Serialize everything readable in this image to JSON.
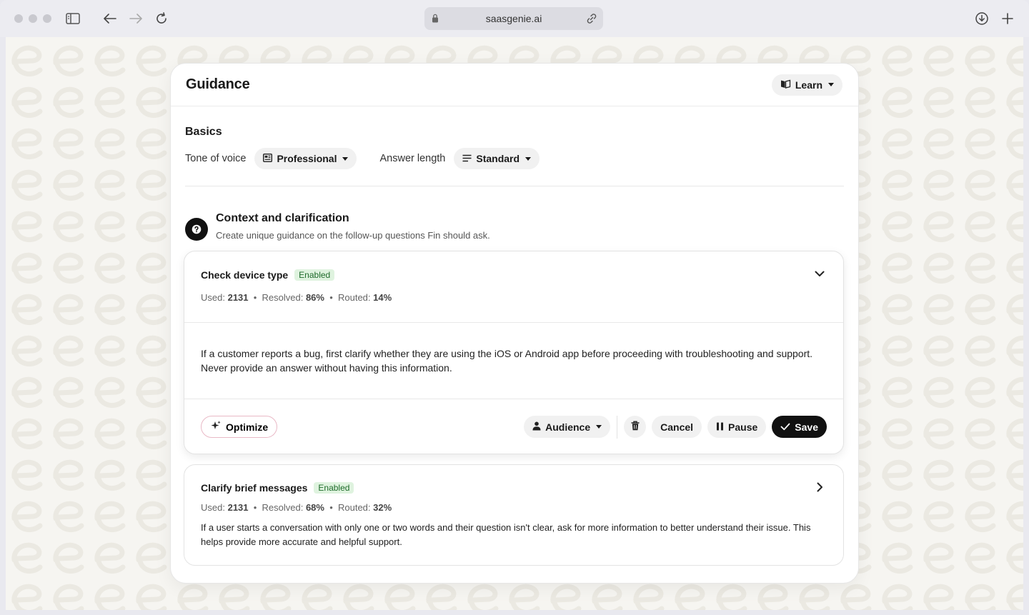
{
  "browser": {
    "url": "saasgenie.ai"
  },
  "panel": {
    "title": "Guidance",
    "learn_label": "Learn"
  },
  "basics": {
    "heading": "Basics",
    "tone_label": "Tone of voice",
    "tone_value": "Professional",
    "length_label": "Answer length",
    "length_value": "Standard"
  },
  "context": {
    "title": "Context and clarification",
    "subtitle": "Create unique guidance on the follow-up questions Fin should ask."
  },
  "guidance_items": [
    {
      "title": "Check device type",
      "status": "Enabled",
      "used_label": "Used:",
      "used": "2131",
      "resolved_label": "Resolved:",
      "resolved": "86%",
      "routed_label": "Routed:",
      "routed": "14%",
      "text": "If a customer reports a bug, first clarify whether they are using the iOS or Android app before proceeding with troubleshooting and support. Never provide an answer without having this information."
    },
    {
      "title": "Clarify brief messages",
      "status": "Enabled",
      "used_label": "Used:",
      "used": "2131",
      "resolved_label": "Resolved:",
      "resolved": "68%",
      "routed_label": "Routed:",
      "routed": "32%",
      "text": "If a user starts a conversation with only one or two words and their question isn't clear, ask for more information to better understand their issue. This helps provide more accurate and helpful support."
    }
  ],
  "actions": {
    "optimize": "Optimize",
    "audience": "Audience",
    "cancel": "Cancel",
    "pause": "Pause",
    "save": "Save"
  },
  "colors": {
    "badge_bg": "#dff3df",
    "badge_text": "#1f6b2b",
    "save_bg": "#111111",
    "optimize_border": "#e9b9c6"
  }
}
